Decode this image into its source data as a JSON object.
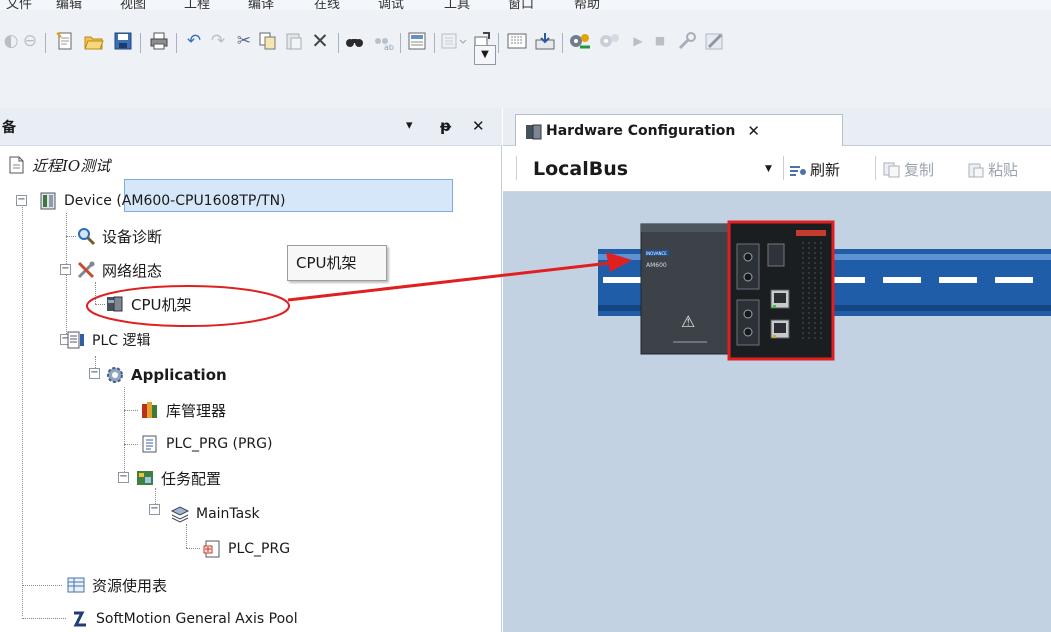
{
  "menubar": {
    "items": [
      "文件",
      "编辑",
      "视图",
      "工程",
      "编译",
      "在线",
      "调试",
      "工具",
      "窗口",
      "帮助"
    ]
  },
  "toolbar": {
    "icons": [
      "forward-icon",
      "new-icon",
      "open-icon",
      "save-icon",
      "print-icon",
      "undo-icon",
      "redo-icon",
      "cut-icon",
      "copy-icon",
      "paste-icon",
      "delete-icon",
      "find-icon",
      "replace-icon",
      "device-icon",
      "add-icon",
      "object-icon",
      "build-icon",
      "generate-icon",
      "login-icon",
      "logout-icon",
      "run-icon",
      "stop-icon",
      "tools-icon",
      "edit-icon"
    ]
  },
  "devices_panel": {
    "title": "备",
    "dropdown_glyph": "▾",
    "pin_glyph": "ᵽ",
    "close_glyph": "✕",
    "combo_glyph": "▼"
  },
  "tree": {
    "project": "近程IO测试",
    "device": "Device (AM600-CPU1608TP/TN)",
    "diagnostics": "设备诊断",
    "network": "网络组态",
    "cpu_rack": "CPU机架",
    "plc_logic": "PLC 逻辑",
    "application": "Application",
    "library_manager": "库管理器",
    "plc_prg_program": "PLC_PRG (PRG)",
    "task_config": "任务配置",
    "main_task": "MainTask",
    "plc_prg_call": "PLC_PRG",
    "resource_table": "资源使用表",
    "softmotion_pool": "SoftMotion General Axis Pool"
  },
  "tooltip": {
    "text": "CPU机架"
  },
  "editor": {
    "tab_label": "Hardware Configuration",
    "tab_close": "✕",
    "bus_value": "LocalBus",
    "bus_arrow": "▼",
    "refresh_label": "刷新",
    "copy_label": "复制",
    "paste_label": "粘贴"
  },
  "hardware": {
    "cpu_brand": "INOVANCE",
    "cpu_model": "AM600",
    "warning_glyph": "⚠"
  },
  "colors": {
    "annotation_red": "#e02020",
    "selection_fill": "#d5e7f8",
    "canvas_bg": "#c2d2e2",
    "rail_blue": "#1f5da8"
  }
}
